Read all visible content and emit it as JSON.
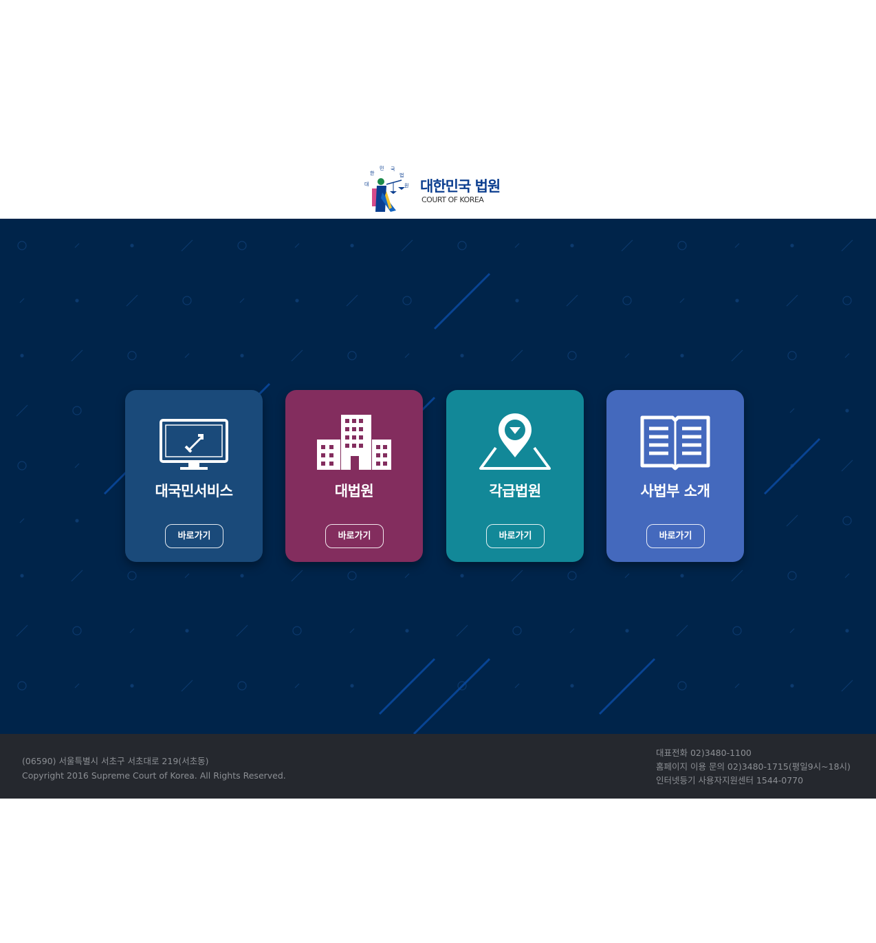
{
  "logo": {
    "title": "대한민국 법원",
    "subtitle": "COURT OF KOREA",
    "emblem_text": "대 한 민 국 법 원"
  },
  "cards": [
    {
      "title": "대국민서비스",
      "button": "바로가기",
      "icon": "monitor-cursor-icon",
      "color": "#1a4a7a"
    },
    {
      "title": "대법원",
      "button": "바로가기",
      "icon": "building-icon",
      "color": "#832d5e"
    },
    {
      "title": "각급법원",
      "button": "바로가기",
      "icon": "map-pin-icon",
      "color": "#128898"
    },
    {
      "title": "사법부 소개",
      "button": "바로가기",
      "icon": "open-book-icon",
      "color": "#4469bd"
    }
  ],
  "footer": {
    "address": "(06590) 서울특별시 서초구 서초대로 219(서초동)",
    "copyright": "Copyright 2016 Supreme Court of Korea. All Rights Reserved.",
    "phone_main": "대표전화 02)3480-1100",
    "phone_homepage": "홈페이지 이용 문의 02)3480-1715(평일9시~18시)",
    "phone_registry": "인터넷등기 사용자지원센터 1544-0770"
  },
  "colors": {
    "hero_bg": "#00244a",
    "footer_bg": "#25282e",
    "brand": "#0a3d8f"
  }
}
